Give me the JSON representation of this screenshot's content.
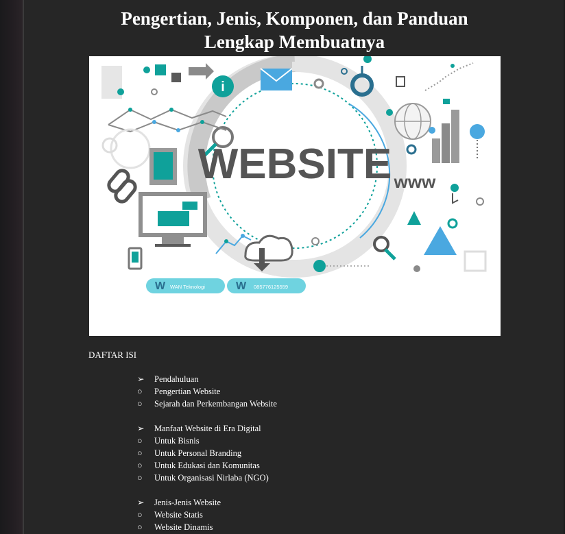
{
  "document": {
    "title_line1": "Pengertian, Jenis, Komponen, dan Panduan",
    "title_line2": "Lengkap Membuatnya"
  },
  "image": {
    "headline": "WEBSITE",
    "www_text": "www",
    "badge1_text": "WAN Teknologi",
    "badge2_text": "085776125559",
    "colors": {
      "teal": "#0fa19a",
      "blue": "#4aa8e0",
      "gray": "#5a5a5a"
    }
  },
  "toc": {
    "heading": "DAFTAR ISI",
    "sections": [
      {
        "title": "Pendahuluan",
        "items": [
          "Pengertian Website",
          "Sejarah dan Perkembangan Website"
        ]
      },
      {
        "title": "Manfaat Website di Era Digital",
        "items": [
          "Untuk Bisnis",
          "Untuk Personal Branding",
          "Untuk Edukasi dan Komunitas",
          "Untuk Organisasi Nirlaba (NGO)"
        ]
      },
      {
        "title": "Jenis-Jenis Website",
        "items": [
          "Website Statis",
          "Website Dinamis"
        ]
      }
    ],
    "section_bullet": "➢",
    "item_bullet": "○"
  }
}
